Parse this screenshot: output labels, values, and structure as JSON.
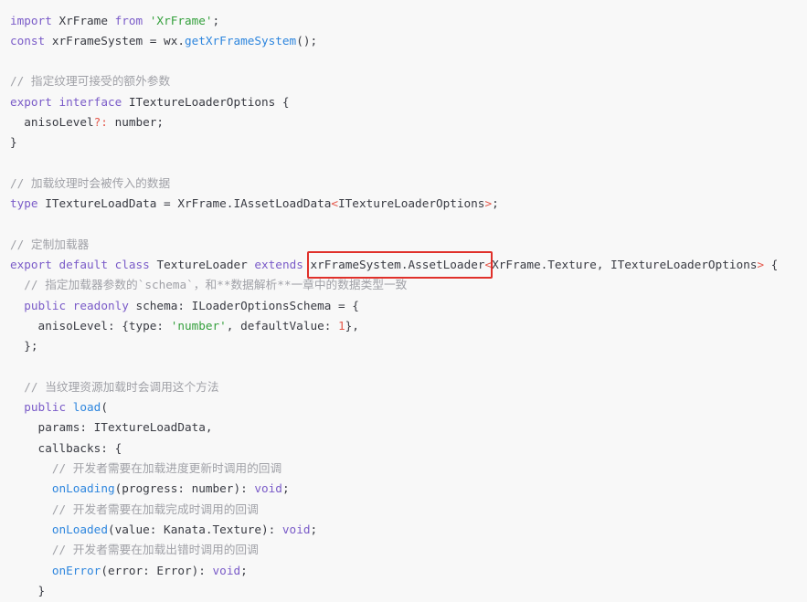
{
  "colors": {
    "background": "#f8f8f8",
    "plain": "#383a42",
    "keyword": "#7a5bc8",
    "string": "#35a03d",
    "function": "#2e86de",
    "comment": "#a0a1a7",
    "operator": "#e4574a",
    "highlight_box": "#e0302a"
  },
  "code": {
    "lines": [
      {
        "tokens": [
          {
            "text": "import",
            "color": "#7a5bc8"
          },
          {
            "text": " XrFrame "
          },
          {
            "text": "from",
            "color": "#7a5bc8"
          },
          {
            "text": " "
          },
          {
            "text": "'XrFrame'",
            "color": "#35a03d"
          },
          {
            "text": ";"
          }
        ]
      },
      {
        "tokens": [
          {
            "text": "const",
            "color": "#7a5bc8"
          },
          {
            "text": " xrFrameSystem = wx."
          },
          {
            "text": "getXrFrameSystem",
            "color": "#2e86de"
          },
          {
            "text": "();"
          }
        ]
      },
      {
        "tokens": []
      },
      {
        "tokens": [
          {
            "text": "// 指定纹理可接受的额外参数",
            "color": "#a0a1a7"
          }
        ]
      },
      {
        "tokens": [
          {
            "text": "export",
            "color": "#7a5bc8"
          },
          {
            "text": " "
          },
          {
            "text": "interface",
            "color": "#7a5bc8"
          },
          {
            "text": " ITextureLoaderOptions {"
          }
        ]
      },
      {
        "tokens": [
          {
            "text": "  anisoLevel"
          },
          {
            "text": "?:",
            "color": "#e4574a"
          },
          {
            "text": " number;"
          }
        ]
      },
      {
        "tokens": [
          {
            "text": "}"
          }
        ]
      },
      {
        "tokens": []
      },
      {
        "tokens": [
          {
            "text": "// 加载纹理时会被传入的数据",
            "color": "#a0a1a7"
          }
        ]
      },
      {
        "tokens": [
          {
            "text": "type",
            "color": "#7a5bc8"
          },
          {
            "text": " ITextureLoadData = XrFrame.IAssetLoadData"
          },
          {
            "text": "<",
            "color": "#e4574a"
          },
          {
            "text": "ITextureLoaderOptions"
          },
          {
            "text": ">",
            "color": "#e4574a"
          },
          {
            "text": ";"
          }
        ]
      },
      {
        "tokens": []
      },
      {
        "tokens": [
          {
            "text": "// 定制加载器",
            "color": "#a0a1a7"
          }
        ]
      },
      {
        "tokens": [
          {
            "text": "export",
            "color": "#7a5bc8"
          },
          {
            "text": " "
          },
          {
            "text": "default",
            "color": "#7a5bc8"
          },
          {
            "text": " "
          },
          {
            "text": "class",
            "color": "#7a5bc8"
          },
          {
            "text": " TextureLoader "
          },
          {
            "text": "extends",
            "color": "#7a5bc8"
          },
          {
            "text": " "
          },
          {
            "text": "xrFrameSystem.AssetLoader",
            "highlighted": true
          },
          {
            "text": "<",
            "color": "#e4574a"
          },
          {
            "text": "XrFrame.Texture, ITextureLoaderOptions"
          },
          {
            "text": ">",
            "color": "#e4574a"
          },
          {
            "text": " {"
          }
        ]
      },
      {
        "tokens": [
          {
            "text": "  "
          },
          {
            "text": "// 指定加载器参数的`schema`，和**数据解析**一章中的数据类型一致",
            "color": "#a0a1a7"
          }
        ]
      },
      {
        "tokens": [
          {
            "text": "  "
          },
          {
            "text": "public",
            "color": "#7a5bc8"
          },
          {
            "text": " "
          },
          {
            "text": "readonly",
            "color": "#7a5bc8"
          },
          {
            "text": " schema: ILoaderOptionsSchema = {"
          }
        ]
      },
      {
        "tokens": [
          {
            "text": "    anisoLevel: {type: "
          },
          {
            "text": "'number'",
            "color": "#35a03d"
          },
          {
            "text": ", defaultValue: "
          },
          {
            "text": "1",
            "color": "#e4574a"
          },
          {
            "text": "},"
          }
        ]
      },
      {
        "tokens": [
          {
            "text": "  };"
          }
        ]
      },
      {
        "tokens": []
      },
      {
        "tokens": [
          {
            "text": "  "
          },
          {
            "text": "// 当纹理资源加载时会调用这个方法",
            "color": "#a0a1a7"
          }
        ]
      },
      {
        "tokens": [
          {
            "text": "  "
          },
          {
            "text": "public",
            "color": "#7a5bc8"
          },
          {
            "text": " "
          },
          {
            "text": "load",
            "color": "#2e86de"
          },
          {
            "text": "("
          }
        ]
      },
      {
        "tokens": [
          {
            "text": "    params: ITextureLoadData,"
          }
        ]
      },
      {
        "tokens": [
          {
            "text": "    callbacks: {"
          }
        ]
      },
      {
        "tokens": [
          {
            "text": "      "
          },
          {
            "text": "// 开发者需要在加载进度更新时调用的回调",
            "color": "#a0a1a7"
          }
        ]
      },
      {
        "tokens": [
          {
            "text": "      "
          },
          {
            "text": "onLoading",
            "color": "#2e86de"
          },
          {
            "text": "(progress: number): "
          },
          {
            "text": "void",
            "color": "#7a5bc8"
          },
          {
            "text": ";"
          }
        ]
      },
      {
        "tokens": [
          {
            "text": "      "
          },
          {
            "text": "// 开发者需要在加载完成时调用的回调",
            "color": "#a0a1a7"
          }
        ]
      },
      {
        "tokens": [
          {
            "text": "      "
          },
          {
            "text": "onLoaded",
            "color": "#2e86de"
          },
          {
            "text": "(value: Kanata.Texture): "
          },
          {
            "text": "void",
            "color": "#7a5bc8"
          },
          {
            "text": ";"
          }
        ]
      },
      {
        "tokens": [
          {
            "text": "      "
          },
          {
            "text": "// 开发者需要在加载出错时调用的回调",
            "color": "#a0a1a7"
          }
        ]
      },
      {
        "tokens": [
          {
            "text": "      "
          },
          {
            "text": "onError",
            "color": "#2e86de"
          },
          {
            "text": "(error: Error): "
          },
          {
            "text": "void",
            "color": "#7a5bc8"
          },
          {
            "text": ";"
          }
        ]
      },
      {
        "tokens": [
          {
            "text": "    }"
          }
        ]
      }
    ]
  }
}
